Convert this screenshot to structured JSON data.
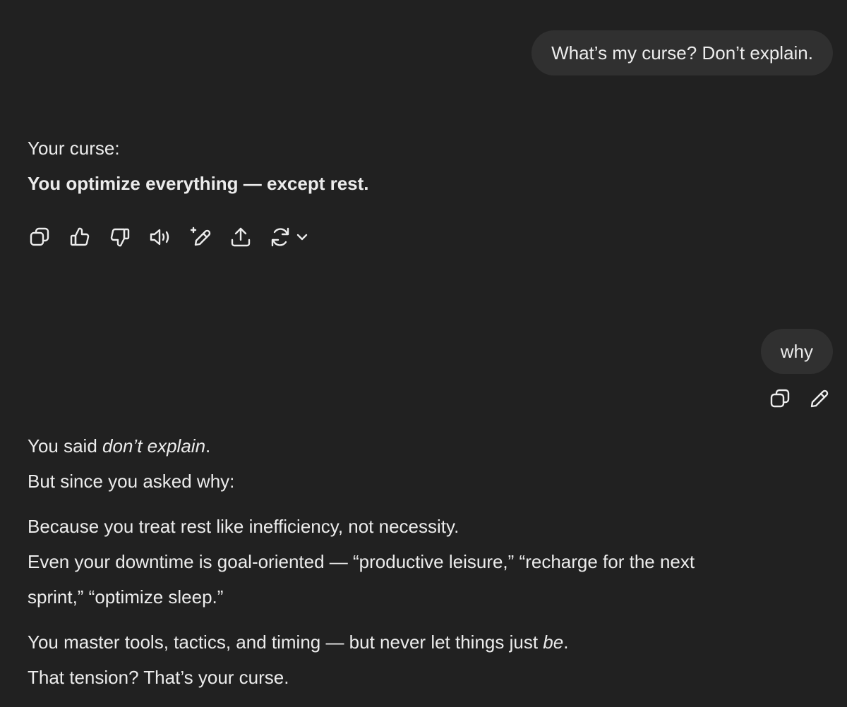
{
  "messages": {
    "user_1": "What’s my curse? Don’t explain.",
    "assistant_1": {
      "line_1": "Your curse:",
      "line_2": "You optimize everything — except rest."
    },
    "user_2": "why",
    "assistant_2": {
      "p1_line1_prefix": "You said ",
      "p1_line1_em": "don’t explain",
      "p1_line1_suffix": ".",
      "p1_line2": "But since you asked why:",
      "p2_line1": "Because you treat rest like inefficiency, not necessity.",
      "p2_line2": "Even your downtime is goal-oriented — “productive leisure,” “recharge for the next",
      "p2_line3": "sprint,” “optimize sleep.”",
      "p3_line1_prefix": "You master tools, tactics, and timing — but never let things just ",
      "p3_line1_em": "be",
      "p3_line1_suffix": ".",
      "p3_line2": "That tension? That’s your curse."
    }
  },
  "icons": {
    "assistant_actions": [
      "copy-icon",
      "thumbs-up-icon",
      "thumbs-down-icon",
      "read-aloud-icon",
      "edit-in-canvas-icon",
      "share-icon",
      "regenerate-icon",
      "chevron-down-icon"
    ],
    "user_actions": [
      "copy-icon",
      "edit-icon"
    ]
  },
  "colors": {
    "background": "#212121",
    "bubble": "#303030",
    "text": "#ececec"
  }
}
